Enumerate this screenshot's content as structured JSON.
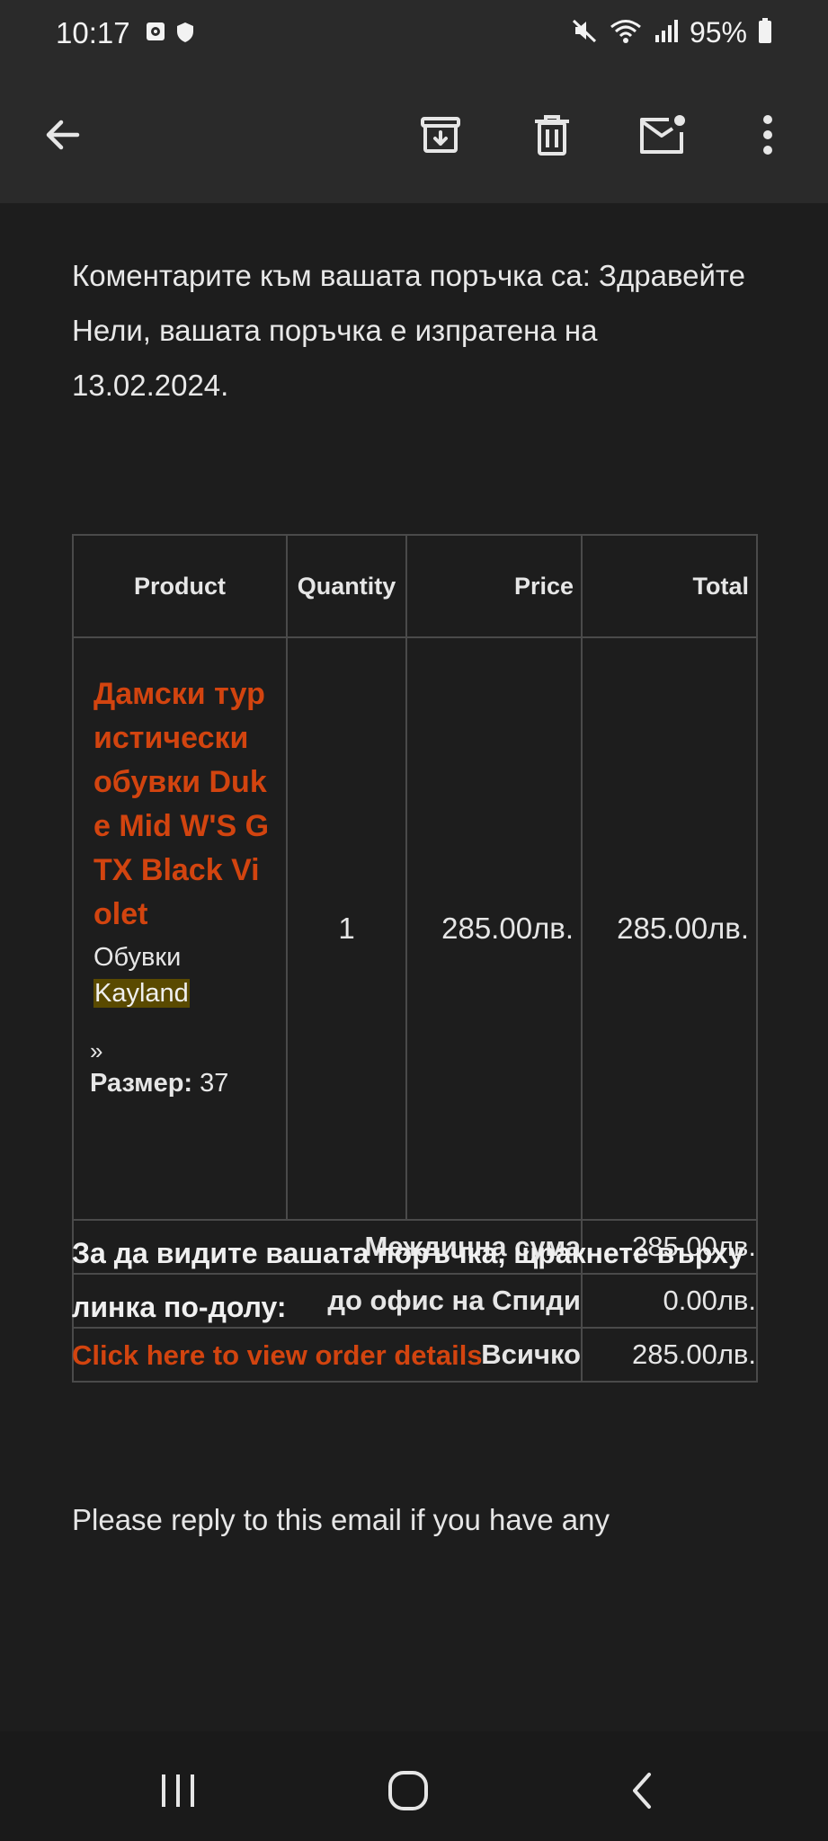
{
  "status_bar": {
    "time": "10:17",
    "battery": "95%"
  },
  "email": {
    "comment_text": "Коментарите към вашата поръчка са: Здравейте Нели, вашата поръчка е изпратена на 13.02.2024.",
    "table": {
      "headers": [
        "Product",
        "Quantity",
        "Price",
        "Total"
      ],
      "item": {
        "name": "Дамски туристически обувки Duke Mid W'S GTX Black Violet",
        "category": "Обувки",
        "brand": "Kayland",
        "arrow": "»",
        "size_label": "Размер:",
        "size_value": "37",
        "quantity": "1",
        "price": "285.00лв.",
        "total": "285.00лв."
      },
      "summary": [
        {
          "label": "Междинна сума",
          "value": "285.00лв."
        },
        {
          "label": "до офис на Спиди",
          "value": "0.00лв."
        },
        {
          "label": "Всичко",
          "value": "285.00лв."
        }
      ]
    },
    "cta_text": "За да видите вашата поръчка, щракнете върху линка по-долу:",
    "cta_link": "Click here to view order details",
    "reply_text": "Please reply to this email if you have any"
  }
}
